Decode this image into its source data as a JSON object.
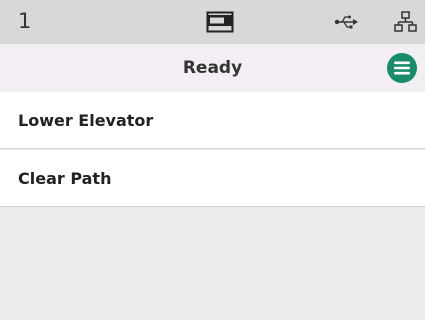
{
  "status_bar": {
    "number": "1",
    "icons": [
      "scanner-icon",
      "usb-icon",
      "network-icon"
    ]
  },
  "title_bar": {
    "title": "Ready",
    "menu_icon": "menu-icon",
    "accent_color": "#1a8c6a"
  },
  "list": {
    "items": [
      {
        "label": "Lower Elevator"
      },
      {
        "label": "Clear Path"
      }
    ]
  }
}
